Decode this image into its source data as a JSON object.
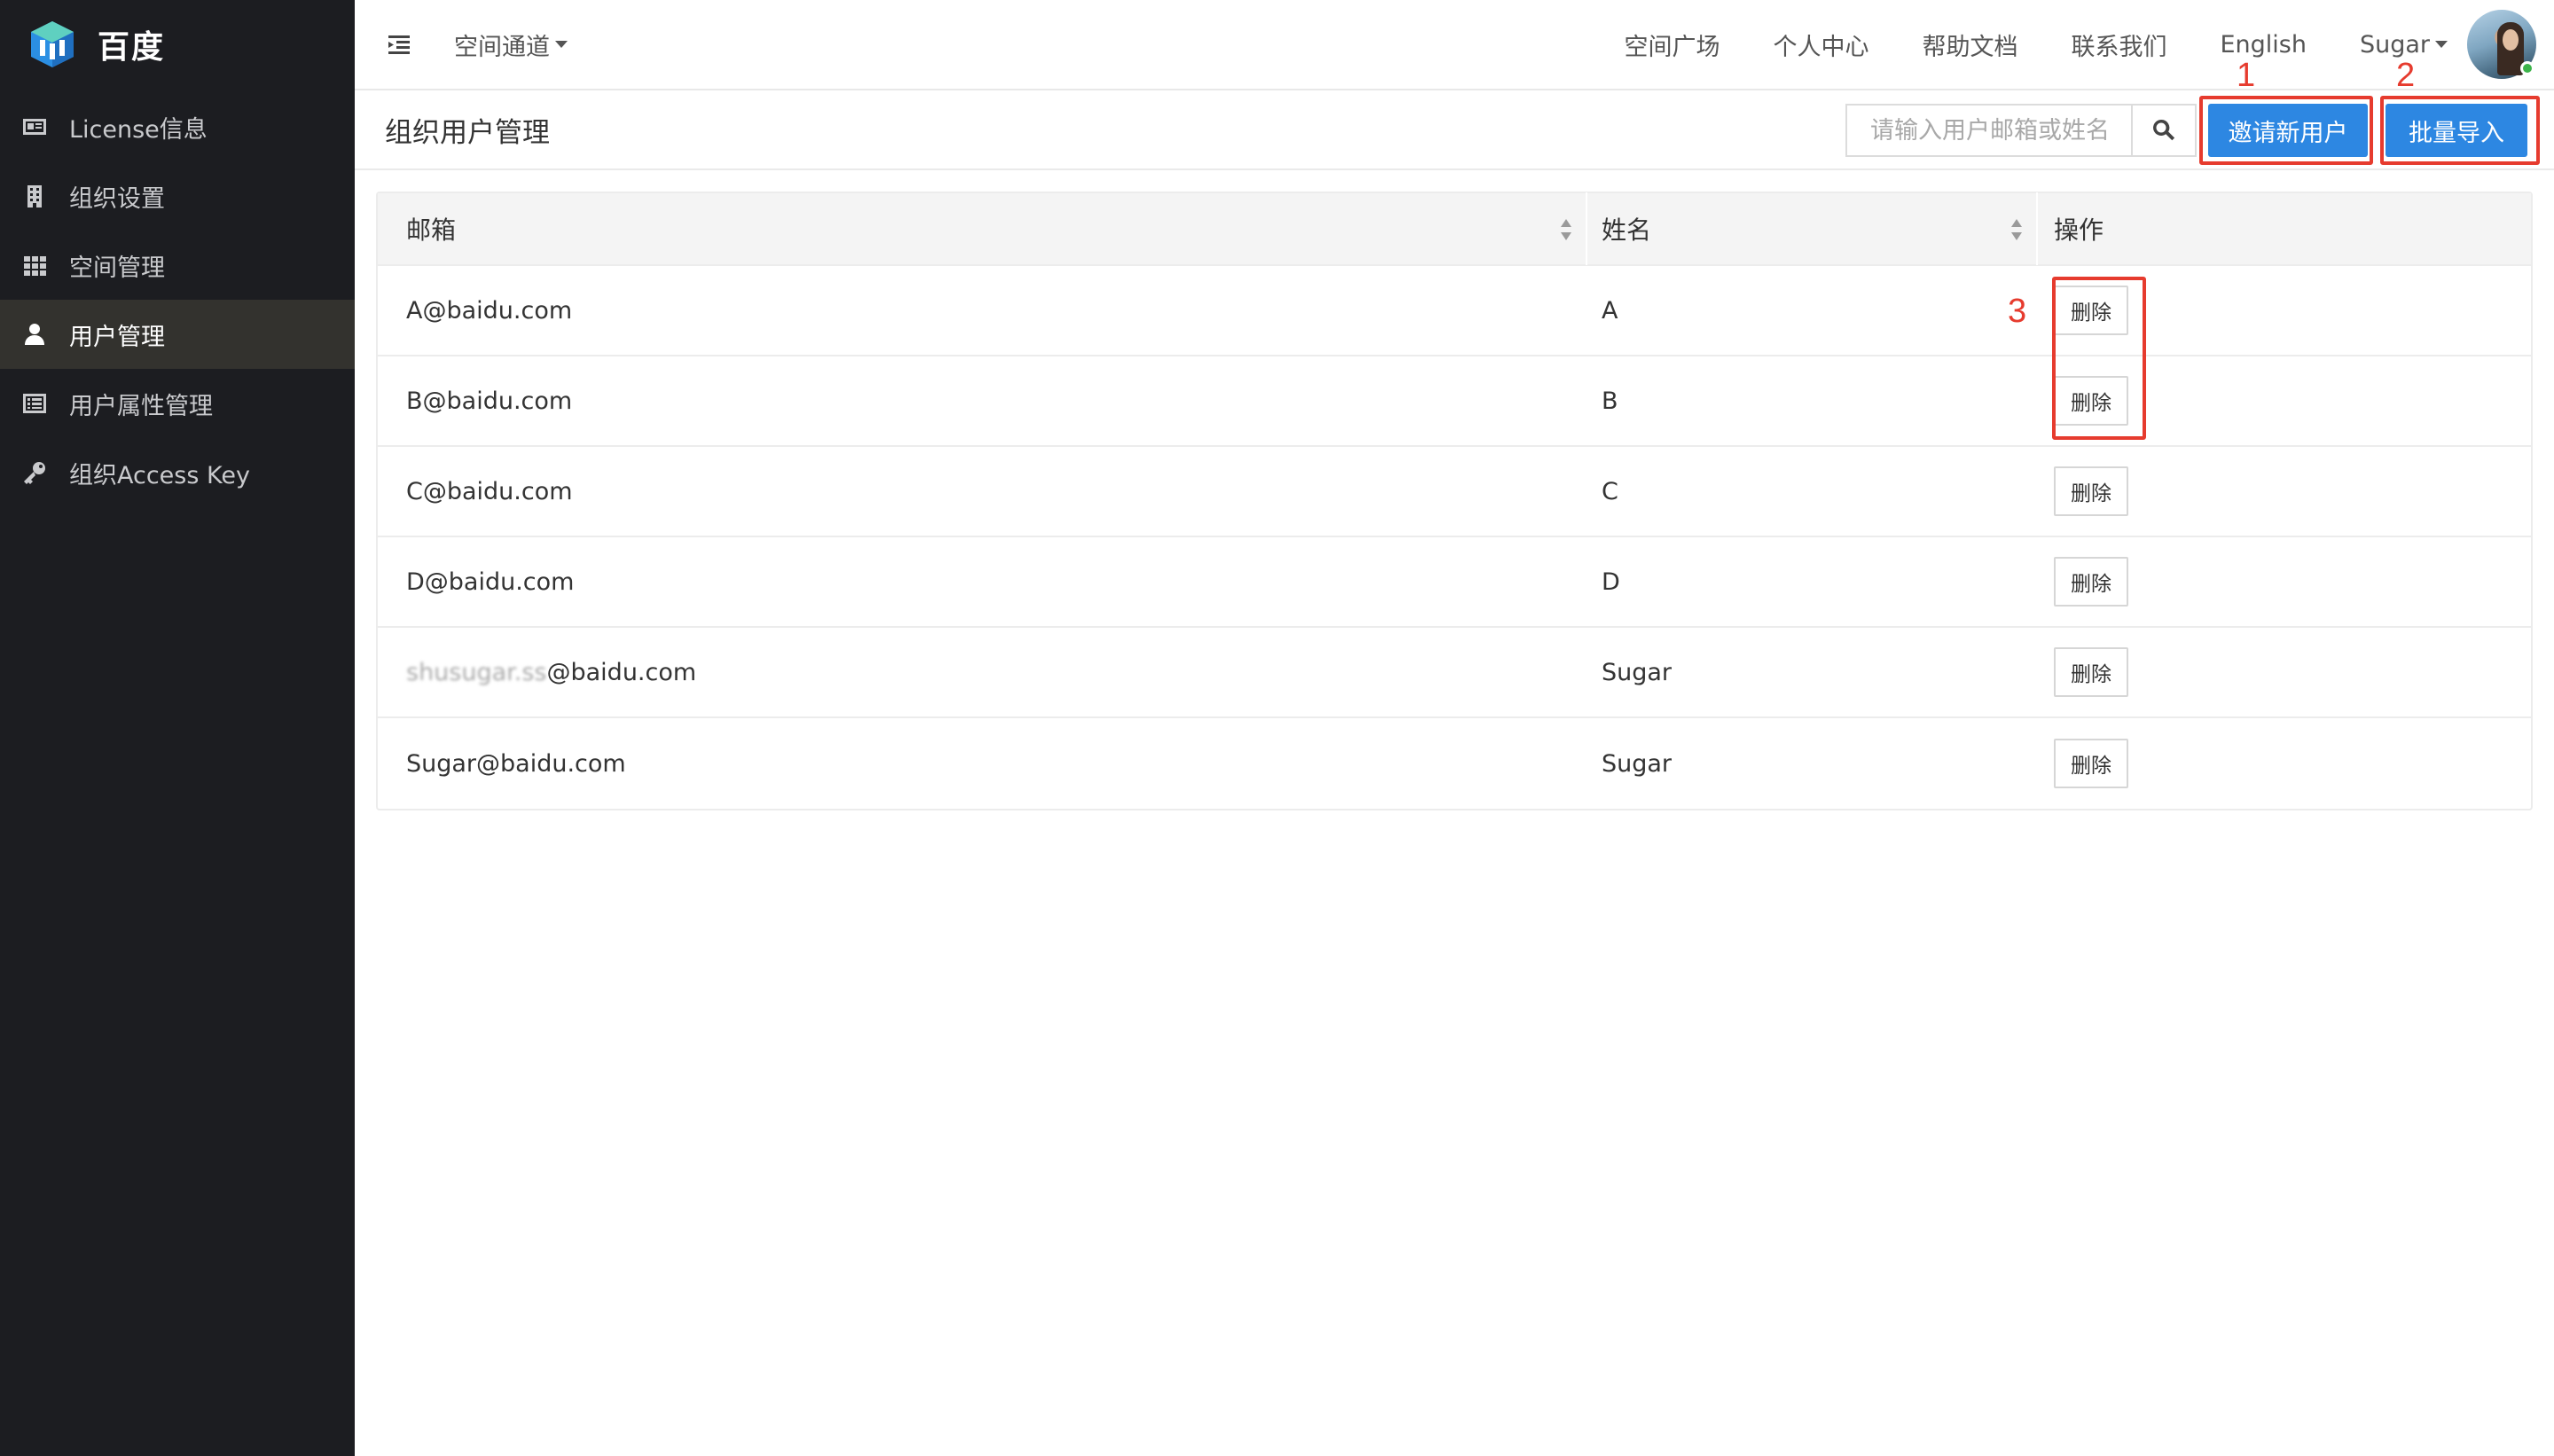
{
  "brand": {
    "name": "百度"
  },
  "sidebar": {
    "items": [
      {
        "label": "License信息",
        "icon": "id-card-icon",
        "active": false
      },
      {
        "label": "组织设置",
        "icon": "building-icon",
        "active": false
      },
      {
        "label": "空间管理",
        "icon": "grid-icon",
        "active": false
      },
      {
        "label": "用户管理",
        "icon": "user-icon",
        "active": true
      },
      {
        "label": "用户属性管理",
        "icon": "list-icon",
        "active": false
      },
      {
        "label": "组织Access Key",
        "icon": "key-icon",
        "active": false
      }
    ]
  },
  "topbar": {
    "space_select": "空间通道",
    "nav": [
      "空间广场",
      "个人中心",
      "帮助文档",
      "联系我们",
      "English"
    ],
    "user": "Sugar"
  },
  "page": {
    "title": "组织用户管理",
    "search_placeholder": "请输入用户邮箱或姓名",
    "invite_label": "邀请新用户",
    "import_label": "批量导入"
  },
  "table": {
    "columns": [
      "邮箱",
      "姓名",
      "操作"
    ],
    "delete_label": "删除",
    "rows": [
      {
        "email": "A@baidu.com",
        "name": "A"
      },
      {
        "email": "B@baidu.com",
        "name": "B"
      },
      {
        "email": "C@baidu.com",
        "name": "C"
      },
      {
        "email": "D@baidu.com",
        "name": "D"
      },
      {
        "email_prefix": "shusugar.ss",
        "email": "@baidu.com",
        "name": "Sugar"
      },
      {
        "email": "Sugar@baidu.com",
        "name": "Sugar"
      }
    ]
  },
  "annotations": [
    "1",
    "2",
    "3"
  ],
  "colors": {
    "sidebar_bg": "#1c1d21",
    "primary": "#2d87e2",
    "annotation": "#e63b2e"
  }
}
